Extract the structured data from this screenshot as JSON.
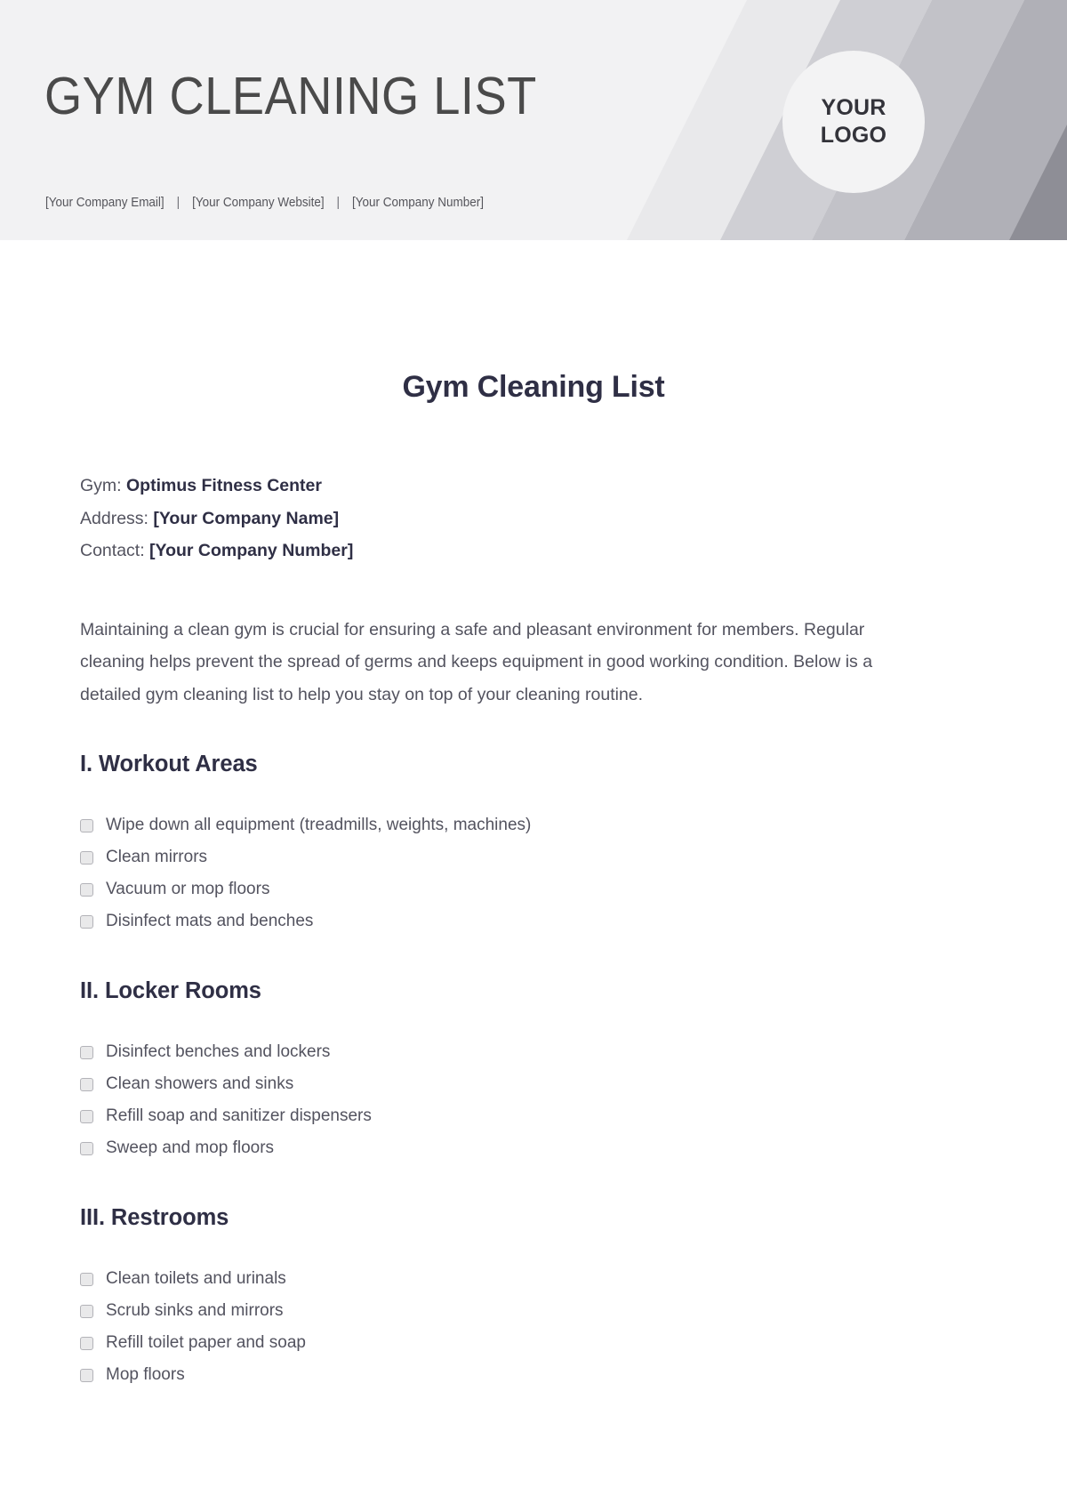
{
  "header": {
    "title": "GYM CLEANING LIST",
    "logo_line1": "YOUR",
    "logo_line2": "LOGO",
    "contact": {
      "email": "[Your Company Email]",
      "website": "[Your Company Website]",
      "number": "[Your Company Number]",
      "separator": "|"
    }
  },
  "document": {
    "title": "Gym Cleaning List",
    "info": [
      {
        "label": "Gym:",
        "value": "Optimus Fitness Center"
      },
      {
        "label": "Address:",
        "value": "[Your Company Name]"
      },
      {
        "label": "Contact:",
        "value": "[Your Company Number]"
      }
    ],
    "intro": "Maintaining a clean gym is crucial for ensuring a safe and pleasant environment for members. Regular cleaning helps prevent the spread of germs and keeps equipment in good working condition. Below is a detailed gym cleaning list to help you stay on top of your cleaning routine.",
    "sections": [
      {
        "heading": "I. Workout Areas",
        "items": [
          "Wipe down all equipment (treadmills, weights, machines)",
          "Clean mirrors",
          "Vacuum or mop floors",
          "Disinfect mats and benches"
        ]
      },
      {
        "heading": "II. Locker Rooms",
        "items": [
          "Disinfect benches and lockers",
          "Clean showers and sinks",
          "Refill soap and sanitizer dispensers",
          "Sweep and mop floors"
        ]
      },
      {
        "heading": "III. Restrooms",
        "items": [
          "Clean toilets and urinals",
          "Scrub sinks and mirrors",
          "Refill toilet paper and soap",
          "Mop floors"
        ]
      }
    ]
  },
  "colors": {
    "header_bg": "#f2f2f3",
    "stripe_1": "#e9e9eb",
    "stripe_2": "#cfcfd4",
    "stripe_3": "#c2c2c8",
    "stripe_4": "#b0b0b7",
    "stripe_5": "#8e8e96",
    "heading_navy": "#2f2f45",
    "body_text": "#53535f",
    "checkbox_fill": "#e9e9ea",
    "checkbox_border": "#b3b3b8"
  }
}
